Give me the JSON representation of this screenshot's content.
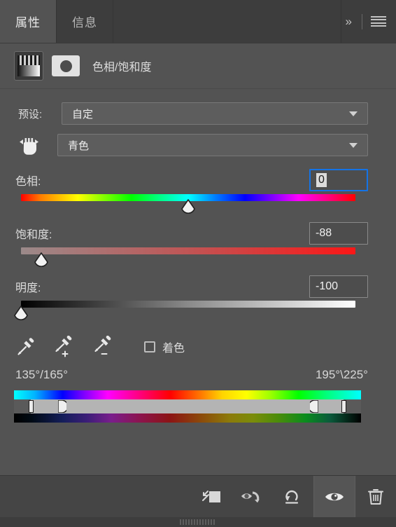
{
  "panel": {
    "tabs": [
      {
        "label": "属性",
        "active": true
      },
      {
        "label": "信息",
        "active": false
      }
    ],
    "expand_icon": "chevron-double-right-icon",
    "menu_icon": "hamburger-menu-icon",
    "adjustment_title": "色相/饱和度",
    "layer_thumb_icon": "hue-saturation-thumbnail",
    "mask_thumb_icon": "layer-mask-thumbnail"
  },
  "preset": {
    "label": "预设:",
    "value": "自定",
    "caret_icon": "chevron-down-icon"
  },
  "channel": {
    "scrubby_icon": "on-image-adjustment-hand-icon",
    "value": "青色",
    "caret_icon": "chevron-down-icon"
  },
  "sliders": {
    "hue": {
      "label": "色相:",
      "value": "0",
      "percent": 50,
      "focused": true,
      "selected": true
    },
    "saturation": {
      "label": "饱和度:",
      "value": "-88",
      "percent": 6,
      "focused": false,
      "selected": false
    },
    "lightness": {
      "label": "明度:",
      "value": "-100",
      "percent": 0,
      "focused": false,
      "selected": false
    }
  },
  "tools": {
    "eyedropper": "eyedropper-icon",
    "eyedropper_add": "eyedropper-add-icon",
    "eyedropper_subtract": "eyedropper-subtract-icon",
    "colorize_label": "着色",
    "colorize_checked": false
  },
  "range": {
    "left_label": "135°/165°",
    "right_label": "195°\\225°",
    "handles": {
      "outer_left_pct": 4.8,
      "inner_left_pct": 14.0,
      "inner_right_pct": 86.5,
      "outer_right_pct": 95.0
    },
    "top_bar_icon": "hue-spectrum-bar",
    "bottom_bar_icon": "result-spectrum-bar"
  },
  "footer": {
    "buttons": [
      {
        "name": "clip-to-layer-button",
        "icon": "clip-to-layer-icon",
        "active": false
      },
      {
        "name": "toggle-preview-button",
        "icon": "eye-arrow-icon",
        "active": false
      },
      {
        "name": "reset-button",
        "icon": "reset-arrow-icon",
        "active": false
      },
      {
        "name": "visibility-button",
        "icon": "eye-icon",
        "active": true
      },
      {
        "name": "delete-button",
        "icon": "trash-icon",
        "active": false
      }
    ]
  },
  "colors": {
    "panel_bg": "#535353",
    "header_bg": "#444444",
    "footer_bg": "#454545",
    "focus_blue": "#1473e6",
    "text": "#dcdcdc"
  }
}
